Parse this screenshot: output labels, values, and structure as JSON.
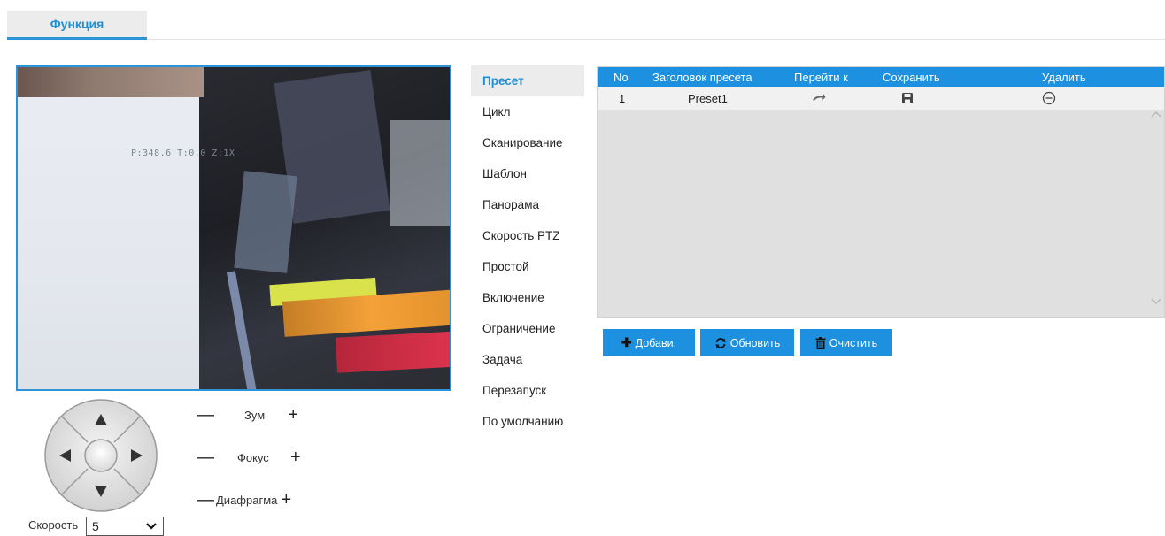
{
  "tab": {
    "label": "Функция"
  },
  "video": {
    "osd_text": "P:348.6 T:0.0 Z:1X"
  },
  "ptz": {
    "zoom_label": "Зум",
    "focus_label": "Фокус",
    "iris_label": "Диафрагма",
    "minus": "—",
    "plus": "+",
    "speed_label": "Скорость",
    "speed_value": "5"
  },
  "menu": {
    "items": [
      {
        "label": "Пресет",
        "active": true
      },
      {
        "label": "Цикл"
      },
      {
        "label": "Сканирование"
      },
      {
        "label": "Шаблон"
      },
      {
        "label": "Панорама"
      },
      {
        "label": "Скорость PTZ"
      },
      {
        "label": "Простой"
      },
      {
        "label": "Включение"
      },
      {
        "label": "Ограничение"
      },
      {
        "label": "Задача"
      },
      {
        "label": "Перезапуск"
      },
      {
        "label": "По умолчанию"
      }
    ]
  },
  "table": {
    "headers": {
      "no": "No",
      "title": "Заголовок пресета",
      "goto": "Перейти к",
      "save": "Сохранить",
      "delete": "Удалить"
    },
    "rows": [
      {
        "no": "1",
        "title": "Preset1"
      }
    ]
  },
  "buttons": {
    "add": "Добави.",
    "refresh": "Обновить",
    "clear": "Очистить"
  },
  "colors": {
    "accent": "#1e90e0",
    "tab_text": "#1f8fd3"
  }
}
